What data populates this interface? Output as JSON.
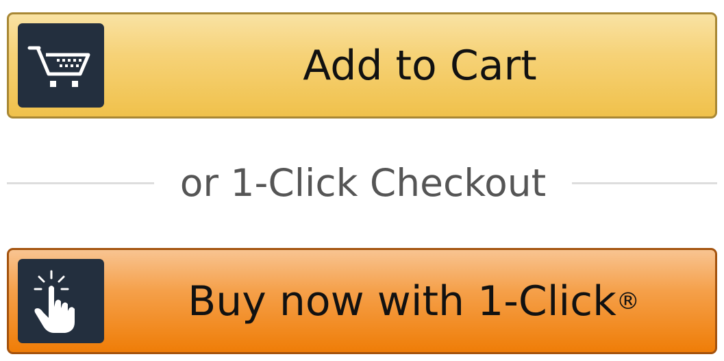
{
  "add_to_cart": {
    "label": "Add to Cart",
    "icon": "shopping-cart-icon"
  },
  "divider": {
    "text": "or 1-Click Checkout"
  },
  "buy_now": {
    "label": "Buy now with 1-Click",
    "trademark": "®",
    "icon": "tap-hand-icon"
  },
  "colors": {
    "cart_button": "#f0c14b",
    "buy_button": "#ef7d07",
    "icon_background": "#232f3e"
  }
}
